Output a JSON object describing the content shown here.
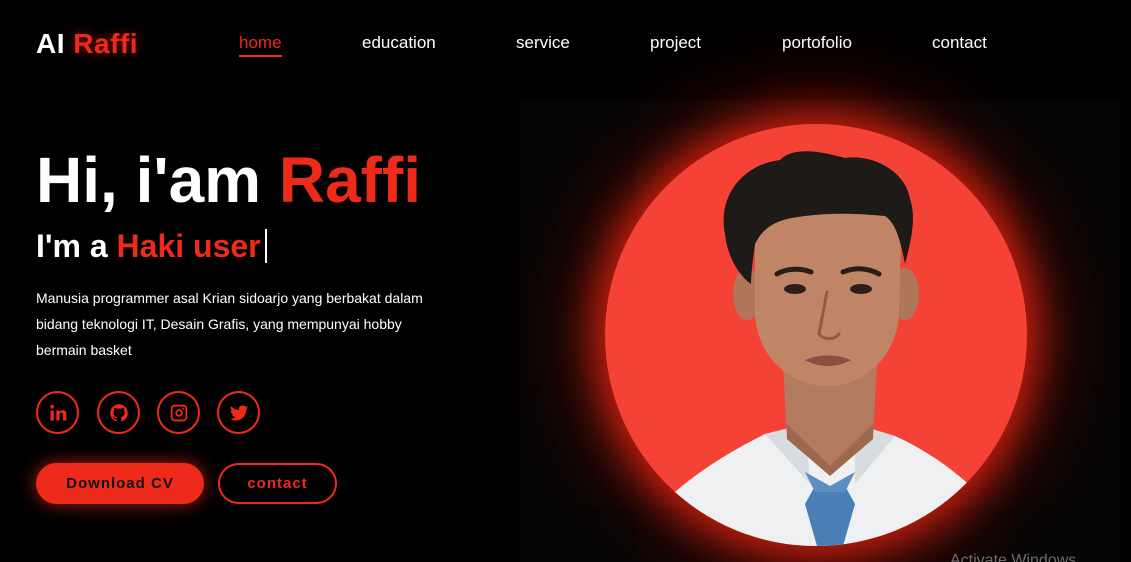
{
  "logo": {
    "prefix": "AI",
    "accent": "Raffi"
  },
  "nav": {
    "items": [
      {
        "label": "home",
        "active": true
      },
      {
        "label": "education",
        "active": false
      },
      {
        "label": "service",
        "active": false
      },
      {
        "label": "project",
        "active": false
      },
      {
        "label": "portofolio",
        "active": false
      },
      {
        "label": "contact",
        "active": false
      }
    ]
  },
  "hero": {
    "greeting": "Hi, i'am",
    "name": "Raffi",
    "sub_prefix": "I'm a",
    "sub_typed": "Haki user",
    "description": "Manusia programmer asal Krian sidoarjo yang berbakat dalam bidang teknologi IT, Desain Grafis, yang mempunyai hobby bermain basket"
  },
  "socials": [
    {
      "icon": "linkedin-icon"
    },
    {
      "icon": "github-icon"
    },
    {
      "icon": "instagram-icon"
    },
    {
      "icon": "twitter-icon"
    }
  ],
  "buttons": {
    "download_cv": "Download CV",
    "contact": "contact"
  },
  "watermark": "Activate Windows",
  "colors": {
    "accent": "#ee2a1b",
    "background": "#000000",
    "portrait_bg": "#f44336"
  }
}
